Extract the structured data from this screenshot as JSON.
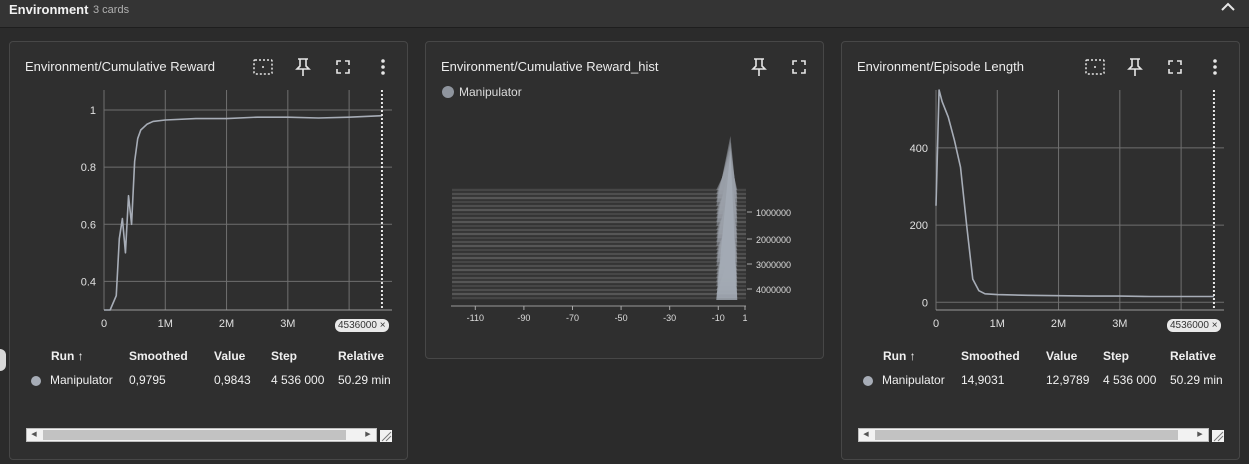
{
  "section": {
    "title": "Environment",
    "count": "3 cards"
  },
  "cards": [
    {
      "title": "Environment/Cumulative Reward",
      "x_ticks": [
        "0",
        "1M",
        "2M",
        "3M",
        "4"
      ],
      "y_ticks": [
        "1",
        "0.8",
        "0.6",
        "0.4"
      ],
      "step_badge": "4536000 ×",
      "table": {
        "headers": [
          "Run ↑",
          "Smoothed",
          "Value",
          "Step",
          "Relative"
        ],
        "row": {
          "run": "Manipulator",
          "smoothed": "0,9795",
          "value": "0,9843",
          "step": "4 536 000",
          "relative": "50.29 min"
        }
      }
    },
    {
      "title": "Environment/Cumulative Reward_hist",
      "legend": "Manipulator",
      "x_ticks": [
        "-110",
        "-90",
        "-70",
        "-50",
        "-30",
        "-10",
        "1"
      ],
      "y_ticks": [
        "1000000",
        "2000000",
        "3000000",
        "4000000"
      ]
    },
    {
      "title": "Environment/Episode Length",
      "x_ticks": [
        "0",
        "1M",
        "2M",
        "3M",
        "4"
      ],
      "y_ticks": [
        "400",
        "200",
        "0"
      ],
      "step_badge": "4536000 ×",
      "table": {
        "headers": [
          "Run ↑",
          "Smoothed",
          "Value",
          "Step",
          "Relative"
        ],
        "row": {
          "run": "Manipulator",
          "smoothed": "14,9031",
          "value": "12,9789",
          "step": "4 536 000",
          "relative": "50.29 min"
        }
      }
    }
  ],
  "chart_data": [
    {
      "type": "line",
      "title": "Environment/Cumulative Reward",
      "xlim": [
        0,
        4700000
      ],
      "ylim": [
        0.3,
        1.07
      ],
      "x_ticks": [
        0,
        1000000,
        2000000,
        3000000,
        4000000
      ],
      "y_ticks": [
        1,
        0.8,
        0.6,
        0.4
      ],
      "series": [
        {
          "name": "Manipulator",
          "x": [
            0,
            100000,
            200000,
            250000,
            300000,
            350000,
            400000,
            450000,
            500000,
            550000,
            600000,
            700000,
            800000,
            1000000,
            1500000,
            2000000,
            2500000,
            3000000,
            3500000,
            4000000,
            4536000
          ],
          "y": [
            0.3,
            0.3,
            0.35,
            0.55,
            0.62,
            0.5,
            0.7,
            0.6,
            0.82,
            0.9,
            0.93,
            0.95,
            0.96,
            0.965,
            0.97,
            0.97,
            0.975,
            0.975,
            0.972,
            0.975,
            0.98
          ]
        }
      ],
      "marker_step": 4536000
    },
    {
      "type": "heatmap",
      "title": "Environment/Cumulative Reward_hist",
      "x_ticks": [
        -110,
        -90,
        -70,
        -50,
        -30,
        -10,
        1
      ],
      "y_ticks": [
        1000000,
        2000000,
        3000000,
        4000000
      ],
      "series": [
        {
          "name": "Manipulator"
        }
      ]
    },
    {
      "type": "line",
      "title": "Environment/Episode Length",
      "xlim": [
        0,
        4700000
      ],
      "ylim": [
        -20,
        550
      ],
      "x_ticks": [
        0,
        1000000,
        2000000,
        3000000,
        4000000
      ],
      "y_ticks": [
        400,
        200,
        0
      ],
      "series": [
        {
          "name": "Manipulator",
          "x": [
            0,
            50000,
            100000,
            200000,
            300000,
            400000,
            500000,
            600000,
            700000,
            800000,
            1000000,
            1500000,
            2000000,
            2500000,
            3000000,
            3500000,
            4000000,
            4536000
          ],
          "y": [
            250,
            550,
            520,
            480,
            420,
            350,
            200,
            60,
            30,
            22,
            20,
            18,
            17,
            16,
            16,
            15,
            15,
            15
          ]
        }
      ],
      "marker_step": 4536000
    }
  ],
  "icons": {
    "fit": "fit-domain-icon",
    "pin": "pin-icon",
    "fullscreen": "fullscreen-icon",
    "more": "more-vert-icon",
    "collapse": "chevron-up-icon"
  },
  "colors": {
    "line": "#a7adb7",
    "grid": "#6f6f6f",
    "card_bg": "#2f2f2f",
    "page_bg": "#2b2b2b"
  }
}
